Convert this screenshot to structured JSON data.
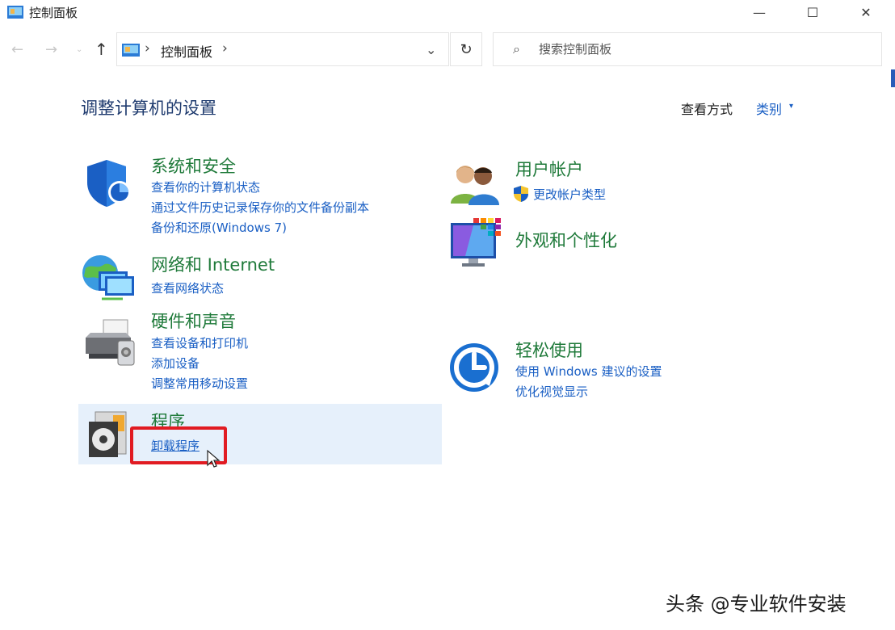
{
  "window": {
    "title": "控制面板",
    "minimize_glyph": "—",
    "maximize_glyph": "☐",
    "close_glyph": "✕"
  },
  "nav": {
    "back_glyph": "←",
    "forward_glyph": "→",
    "recent_glyph": "⌄",
    "up_glyph": "↑",
    "breadcrumb": [
      "控制面板"
    ],
    "separator": "›",
    "dropdown_glyph": "⌄",
    "refresh_glyph": "↻",
    "search_glyph": "⌕",
    "search_placeholder": "搜索控制面板"
  },
  "header": {
    "title": "调整计算机的设置",
    "view_label": "查看方式",
    "view_value": "类别",
    "view_caret": "▾"
  },
  "categories": {
    "system_security": {
      "title": "系统和安全",
      "links": [
        "查看你的计算机状态",
        "通过文件历史记录保存你的文件备份副本",
        "备份和还原(Windows 7)"
      ],
      "icon": "shield-icon"
    },
    "network": {
      "title": "网络和 Internet",
      "links": [
        "查看网络状态"
      ],
      "icon": "network-globe-icon"
    },
    "hardware": {
      "title": "硬件和声音",
      "links": [
        "查看设备和打印机",
        "添加设备",
        "调整常用移动设置"
      ],
      "icon": "printer-icon"
    },
    "programs": {
      "title": "程序",
      "links": [
        "卸载程序"
      ],
      "icon": "programs-disc-icon"
    },
    "user_accounts": {
      "title": "用户帐户",
      "links": [
        "更改帐户类型"
      ],
      "icon": "users-icon"
    },
    "appearance": {
      "title": "外观和个性化",
      "links": [],
      "icon": "monitor-palette-icon"
    },
    "ease_of_access": {
      "title": "轻松使用",
      "links": [
        "使用 Windows 建议的设置",
        "优化视觉显示"
      ],
      "icon": "ease-of-access-icon"
    }
  },
  "watermark": "头条 @专业软件安装",
  "colors": {
    "category_title": "#1f7a3a",
    "link": "#1a5fc4",
    "page_title": "#1e3a6e",
    "highlight_bg": "#e6f0fb",
    "annotation_red": "#e11b22"
  }
}
